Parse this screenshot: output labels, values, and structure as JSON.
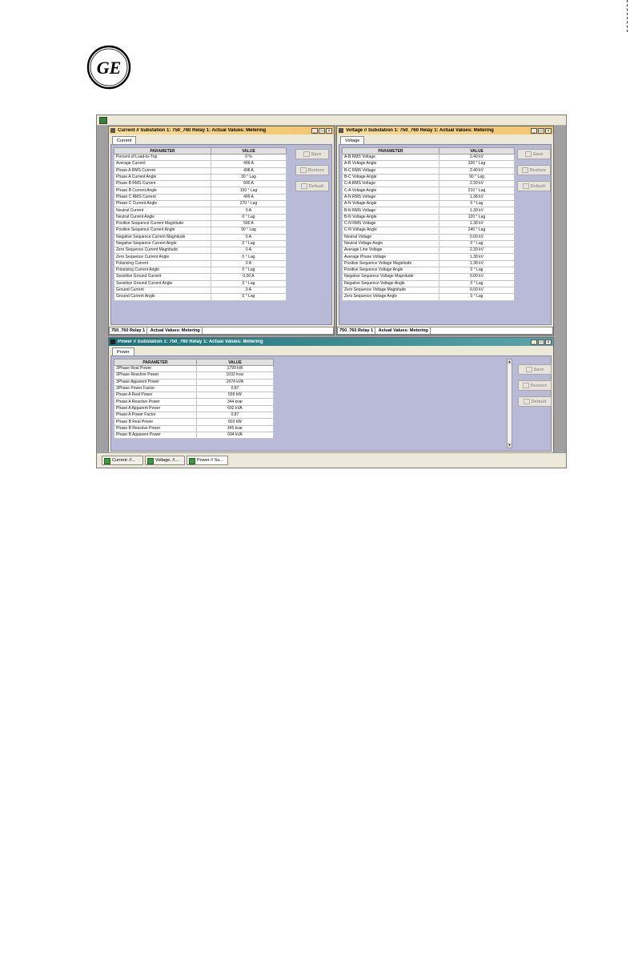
{
  "colors": {
    "current_title": "#f1c46a",
    "voltage_title": "#f1c46a",
    "power_title": "#1a6f78",
    "client_bg": "#b9b9d8"
  },
  "icons": [
    "ge-logo",
    "window-icon",
    "minimize-icon",
    "maximize-icon",
    "close-icon",
    "save-icon",
    "restore-icon",
    "default-icon"
  ],
  "logo": {
    "text": "GE"
  },
  "window_buttons": {
    "min": "_",
    "max": "□",
    "close": "×"
  },
  "buttons": {
    "save": "Save",
    "restore": "Restore",
    "default": "Default"
  },
  "table_headers": {
    "param": "PARAMETER",
    "value": "VALUE"
  },
  "current": {
    "title": "Current // Substation 1: 750_760 Relay 1: Actual Values: Metering",
    "tab": "Current",
    "status_left": "750_760 Relay 1",
    "status_right": "Actual Values: Metering",
    "rows": [
      [
        "Percent of Load-to-Trip",
        "0 %"
      ],
      [
        "Average Current",
        "499 A"
      ],
      [
        "Phase A RMS Current",
        "498 A"
      ],
      [
        "Phase A Current Angle",
        "30 ° Lag"
      ],
      [
        "Phase B RMS Current",
        "500 A"
      ],
      [
        "Phase B Current Angle",
        "150 ° Lag"
      ],
      [
        "Phase C RMS Current",
        "499 A"
      ],
      [
        "Phase C Current Angle",
        "270 ° Lag"
      ],
      [
        "Neutral Current",
        "0 A"
      ],
      [
        "Neutral Current Angle",
        "0 ° Lag"
      ],
      [
        "Positive Sequence Current Magnitude",
        "500 A"
      ],
      [
        "Positive Sequence Current Angle",
        "30 ° Lag"
      ],
      [
        "Negative Sequence Current Magnitude",
        "0 A"
      ],
      [
        "Negative Sequence Current Angle",
        "0 ° Lag"
      ],
      [
        "Zero Sequence Current Magnitude",
        "0 A"
      ],
      [
        "Zero Sequence Current Angle",
        "0 ° Lag"
      ],
      [
        "Polarizing Current",
        "0 A"
      ],
      [
        "Polarizing Current Angle",
        "0 ° Lag"
      ],
      [
        "Sensitive Ground Current",
        "0.00 A"
      ],
      [
        "Sensitive Ground Current Angle",
        "0 ° Lag"
      ],
      [
        "Ground Current",
        "0 A"
      ],
      [
        "Ground Current Angle",
        "0 ° Lag"
      ]
    ]
  },
  "voltage": {
    "title": "Voltage // Substation 1: 750_760 Relay 1: Actual Values: Metering",
    "tab": "Voltage",
    "status_left": "750_760 Relay 1",
    "status_right": "Actual Values: Metering",
    "rows": [
      [
        "A-B RMS Voltage",
        "2.40 kV"
      ],
      [
        "A-B Voltage Angle",
        "330 ° Lag"
      ],
      [
        "B-C RMS Voltage",
        "2.40 kV"
      ],
      [
        "B-C Voltage Angle",
        "90 ° Lag"
      ],
      [
        "C-A RMS Voltage",
        "2.39 kV"
      ],
      [
        "C-A Voltage Angle",
        "210 ° Lag"
      ],
      [
        "A-N RMS Voltage",
        "1.38 kV"
      ],
      [
        "A-N Voltage Angle",
        "0 ° Lag"
      ],
      [
        "B-N RMS Voltage",
        "1.39 kV"
      ],
      [
        "B-N Voltage Angle",
        "120 ° Lag"
      ],
      [
        "C-N RMS Voltage",
        "1.38 kV"
      ],
      [
        "C-N Voltage Angle",
        "240 ° Lag"
      ],
      [
        "Neutral Voltage",
        "0.00 kV"
      ],
      [
        "Neutral Voltage Angle",
        "0 ° Lag"
      ],
      [
        "Average Line Voltage",
        "2.39 kV"
      ],
      [
        "Average Phase Voltage",
        "1.38 kV"
      ],
      [
        "Positive Sequence Voltage Magnitude",
        "1.38 kV"
      ],
      [
        "Positive Sequence Voltage Angle",
        "0 ° Lag"
      ],
      [
        "Negative Sequence Voltage Magnitude",
        "0.00 kV"
      ],
      [
        "Negative Sequence Voltage Angle",
        "0 ° Lag"
      ],
      [
        "Zero Sequence Voltage Magnitude",
        "0.00 kV"
      ],
      [
        "Zero Sequence Voltage Angle",
        "0 ° Lag"
      ]
    ]
  },
  "power": {
    "title": "Power // Substation 1: 750_760 Relay 1: Actual Values: Metering",
    "tab": "Power",
    "rows": [
      [
        "3Phase Real Power",
        "1799 kW"
      ],
      [
        "3Phase Reactive Power",
        "1032 kvar"
      ],
      [
        "3Phase Apparent Power",
        "2074 kVA"
      ],
      [
        "3Phase Power Factor",
        "0.87"
      ],
      [
        "Phase A Real Power",
        "599 kW"
      ],
      [
        "Phase A Reactive Power",
        "344 kvar"
      ],
      [
        "Phase A Apparent Power",
        "692 kVA"
      ],
      [
        "Phase A Power Factor",
        "0.87"
      ],
      [
        "Phase B Real Power",
        "603 kW"
      ],
      [
        "Phase B Reactive Power",
        "345 kvar"
      ],
      [
        "Phase B Apparent Power",
        "694 kVA"
      ]
    ]
  },
  "taskbar": [
    "Current: //...",
    "Voltage. //...",
    "Power // Su..."
  ]
}
